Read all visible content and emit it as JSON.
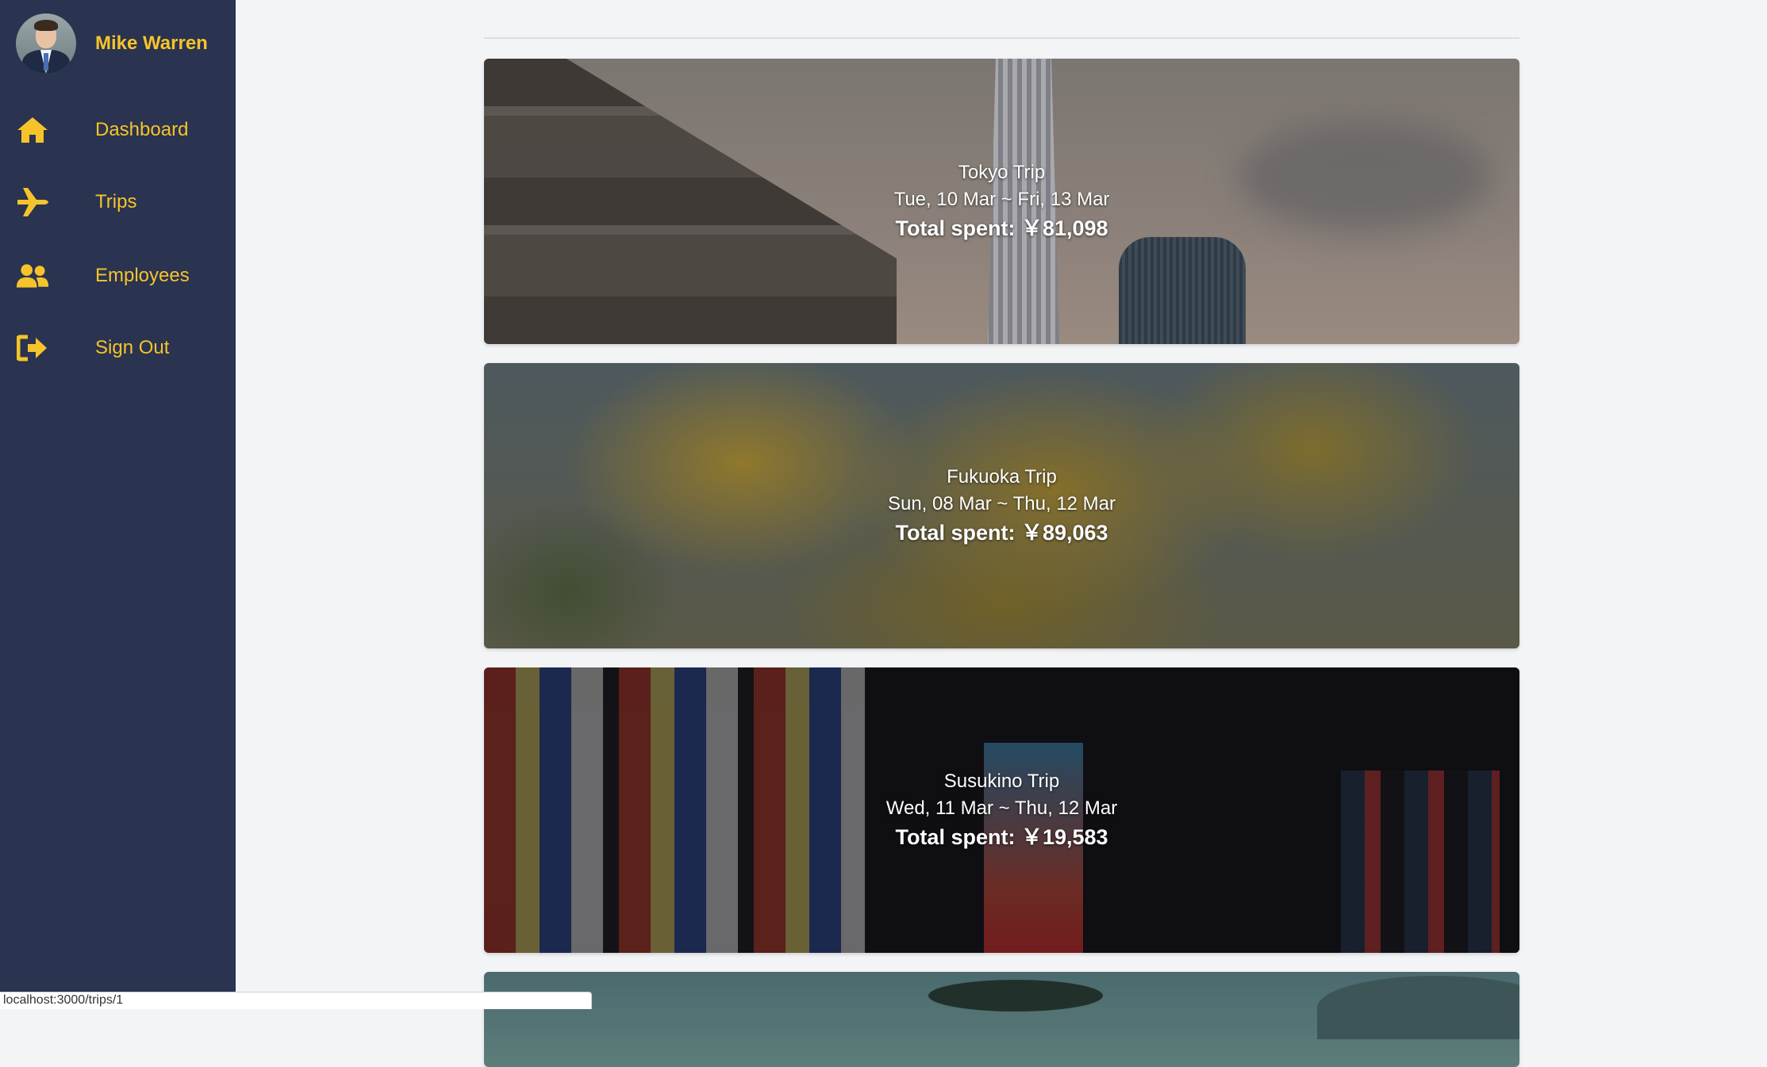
{
  "user": {
    "name": "Mike Warren"
  },
  "nav": [
    {
      "label": "Dashboard",
      "icon": "home-icon"
    },
    {
      "label": "Trips",
      "icon": "airplane-icon"
    },
    {
      "label": "Employees",
      "icon": "users-icon"
    },
    {
      "label": "Sign Out",
      "icon": "sign-out-icon"
    }
  ],
  "accent_color": "#f6c42a",
  "sidebar_color": "#2a3350",
  "trips": [
    {
      "name": "Tokyo Trip",
      "dates": "Tue, 10 Mar ~ Fri, 13 Mar",
      "total": "Total spent: ￥81,098"
    },
    {
      "name": "Fukuoka Trip",
      "dates": "Sun, 08 Mar ~ Thu, 12 Mar",
      "total": "Total spent: ￥89,063"
    },
    {
      "name": "Susukino Trip",
      "dates": "Wed, 11 Mar ~ Thu, 12 Mar",
      "total": "Total spent: ￥19,583"
    }
  ],
  "status_url": "localhost:3000/trips/1"
}
